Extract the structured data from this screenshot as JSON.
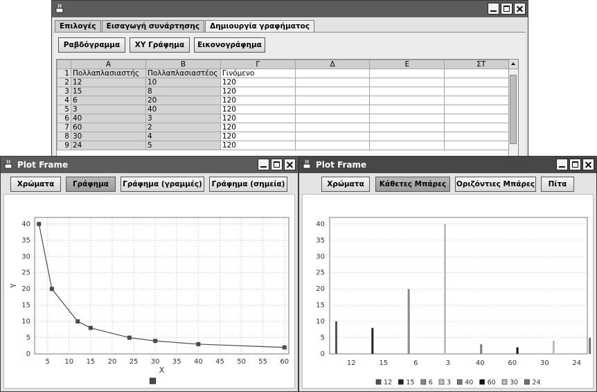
{
  "main_window": {
    "tabs": [
      {
        "label": "Επιλογές"
      },
      {
        "label": "Εισαγωγή συνάρτησης"
      },
      {
        "label": "Δημιουργία γραφήματος"
      }
    ],
    "buttons": [
      {
        "label": "Ραβδόγραμμα"
      },
      {
        "label": "XY Γράφημα"
      },
      {
        "label": "Εικονογράφημα"
      }
    ],
    "sheet": {
      "columns": [
        "A",
        "B",
        "Γ",
        "Δ",
        "Ε",
        "ΣΤ"
      ],
      "rows": [
        {
          "n": "1",
          "cells": [
            "Πολλαπλασιαστής",
            "Πολλαπλασιαστέος",
            "Γινόμενο",
            "",
            "",
            ""
          ]
        },
        {
          "n": "2",
          "cells": [
            "12",
            "10",
            "120",
            "",
            "",
            ""
          ]
        },
        {
          "n": "3",
          "cells": [
            "15",
            "8",
            "120",
            "",
            "",
            ""
          ]
        },
        {
          "n": "4",
          "cells": [
            "6",
            "20",
            "120",
            "",
            "",
            ""
          ]
        },
        {
          "n": "5",
          "cells": [
            "3",
            "40",
            "120",
            "",
            "",
            ""
          ]
        },
        {
          "n": "6",
          "cells": [
            "40",
            "3",
            "120",
            "",
            "",
            ""
          ]
        },
        {
          "n": "7",
          "cells": [
            "60",
            "2",
            "120",
            "",
            "",
            ""
          ]
        },
        {
          "n": "8",
          "cells": [
            "30",
            "4",
            "120",
            "",
            "",
            ""
          ]
        },
        {
          "n": "9",
          "cells": [
            "24",
            "5",
            "120",
            "",
            "",
            ""
          ]
        }
      ]
    }
  },
  "plot_window_1": {
    "title": "Plot Frame",
    "buttons": [
      {
        "label": "Χρώματα"
      },
      {
        "label": "Γράφημα"
      },
      {
        "label": "Γράφημα (γραμμές)"
      },
      {
        "label": "Γράφημα (σημεία)"
      }
    ]
  },
  "plot_window_2": {
    "title": "Plot Frame",
    "buttons": [
      {
        "label": "Χρώματα"
      },
      {
        "label": "Κάθετες Μπάρες"
      },
      {
        "label": "Οριζόντιες Μπάρες"
      },
      {
        "label": "Πίτα"
      }
    ]
  },
  "chart_data": [
    {
      "type": "line",
      "xlabel": "X",
      "ylabel": "Y",
      "xlim": [
        2,
        61
      ],
      "ylim": [
        0,
        42
      ],
      "xticks": [
        5,
        10,
        15,
        20,
        25,
        30,
        35,
        40,
        45,
        50,
        55,
        60
      ],
      "yticks": [
        0,
        5,
        10,
        15,
        20,
        25,
        30,
        35,
        40
      ],
      "grid": true,
      "legend": "bottom-center",
      "series": [
        {
          "color": "#4a4a4a",
          "points": [
            [
              3,
              40
            ],
            [
              6,
              20
            ],
            [
              12,
              10
            ],
            [
              15,
              8
            ],
            [
              24,
              5
            ],
            [
              30,
              4
            ],
            [
              40,
              3
            ],
            [
              60,
              2
            ]
          ]
        }
      ]
    },
    {
      "type": "bar",
      "categories": [
        "12",
        "15",
        "6",
        "3",
        "40",
        "60",
        "30",
        "24"
      ],
      "values": [
        10,
        8,
        20,
        40,
        3,
        2,
        4,
        5
      ],
      "ylim": [
        0,
        42
      ],
      "yticks": [
        0,
        5,
        10,
        15,
        20,
        25,
        30,
        35,
        40
      ],
      "grid": true,
      "legend": "bottom-center",
      "colors": [
        "#555555",
        "#222222",
        "#888888",
        "#c0c0c0",
        "#7a7a7a",
        "#111111",
        "#bdbdbd",
        "#707070"
      ]
    }
  ]
}
